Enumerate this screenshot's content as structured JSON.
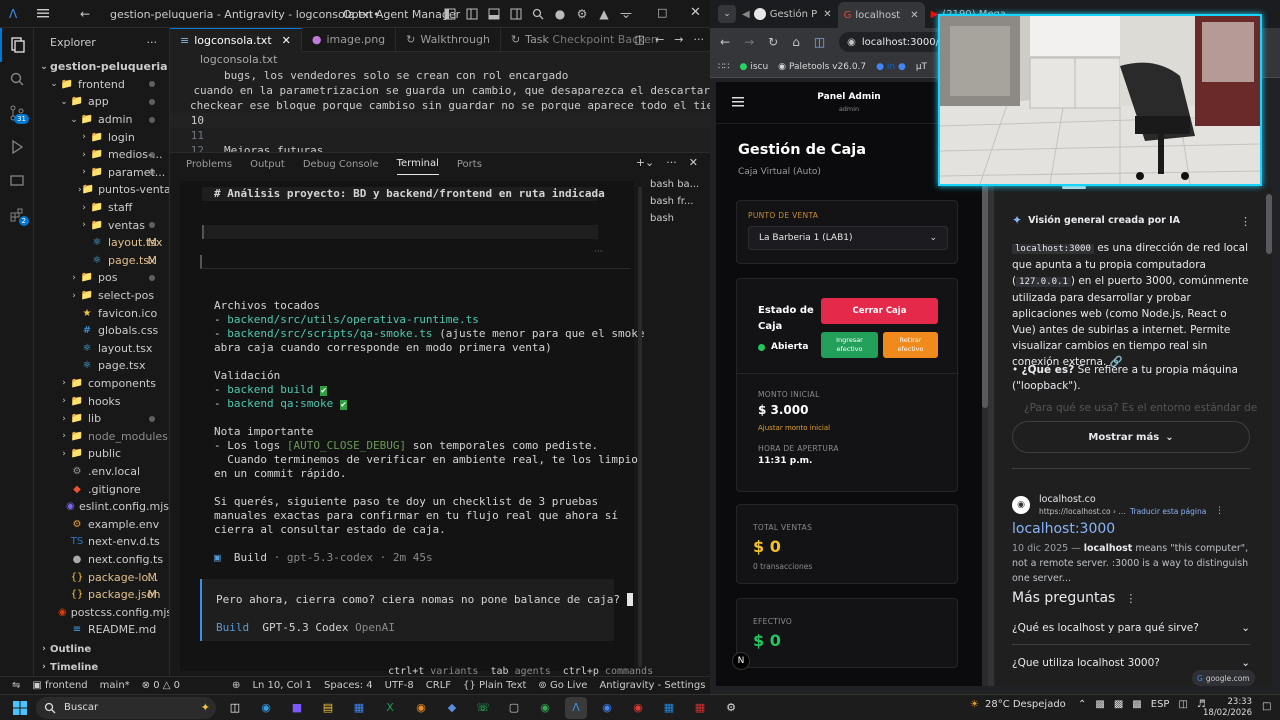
{
  "vscode": {
    "title": "gestion-peluqueria - Antigravity - logconsola.txt•",
    "open_agent_manager": "Open Agent Manager",
    "explorer_label": "Explorer",
    "tree": [
      {
        "label": "gestion-peluqueria",
        "depth": 0,
        "type": "root",
        "chev": "⌄",
        "dot": false
      },
      {
        "label": "frontend",
        "depth": 1,
        "type": "folder",
        "chev": "⌄",
        "dot": true
      },
      {
        "label": "app",
        "depth": 2,
        "type": "folder",
        "chev": "⌄",
        "dot": true
      },
      {
        "label": "admin",
        "depth": 3,
        "type": "folder",
        "chev": "⌄",
        "dot": true
      },
      {
        "label": "login",
        "depth": 4,
        "type": "folder",
        "chev": "›",
        "dot": false
      },
      {
        "label": "medios-...",
        "depth": 4,
        "type": "folder",
        "chev": "›",
        "dot": true
      },
      {
        "label": "paramet...",
        "depth": 4,
        "type": "folder",
        "chev": "›",
        "dot": true
      },
      {
        "label": "puntos-venta",
        "depth": 4,
        "type": "folder",
        "chev": "›",
        "dot": false
      },
      {
        "label": "staff",
        "depth": 4,
        "type": "folder",
        "chev": "›",
        "dot": false
      },
      {
        "label": "ventas",
        "depth": 4,
        "type": "folder",
        "chev": "›",
        "dot": true
      },
      {
        "label": "layout.tsx",
        "depth": 4,
        "type": "tsx",
        "chev": "",
        "m": "M"
      },
      {
        "label": "page.tsx",
        "depth": 4,
        "type": "tsx",
        "chev": "",
        "m": "M"
      },
      {
        "label": "pos",
        "depth": 3,
        "type": "folder",
        "chev": "›",
        "dot": true
      },
      {
        "label": "select-pos",
        "depth": 3,
        "type": "folder",
        "chev": "›",
        "dot": false
      },
      {
        "label": "favicon.ico",
        "depth": 3,
        "type": "ico",
        "chev": ""
      },
      {
        "label": "globals.css",
        "depth": 3,
        "type": "css",
        "chev": ""
      },
      {
        "label": "layout.tsx",
        "depth": 3,
        "type": "tsx",
        "chev": ""
      },
      {
        "label": "page.tsx",
        "depth": 3,
        "type": "tsx",
        "chev": ""
      },
      {
        "label": "components",
        "depth": 2,
        "type": "folder",
        "chev": "›",
        "dot": false
      },
      {
        "label": "hooks",
        "depth": 2,
        "type": "folder",
        "chev": "›",
        "dot": false
      },
      {
        "label": "lib",
        "depth": 2,
        "type": "folder",
        "chev": "›",
        "dot": true
      },
      {
        "label": "node_modules",
        "depth": 2,
        "type": "folder-dim",
        "chev": "›",
        "dot": false
      },
      {
        "label": "public",
        "depth": 2,
        "type": "folder",
        "chev": "›",
        "dot": false
      },
      {
        "label": ".env.local",
        "depth": 2,
        "type": "env",
        "chev": ""
      },
      {
        "label": ".gitignore",
        "depth": 2,
        "type": "git",
        "chev": ""
      },
      {
        "label": "eslint.config.mjs",
        "depth": 2,
        "type": "js",
        "chev": ""
      },
      {
        "label": "example.env",
        "depth": 2,
        "type": "env2",
        "chev": ""
      },
      {
        "label": "next-env.d.ts",
        "depth": 2,
        "type": "ts",
        "chev": ""
      },
      {
        "label": "next.config.ts",
        "depth": 2,
        "type": "ts2",
        "chev": ""
      },
      {
        "label": "package-lo...",
        "depth": 2,
        "type": "json",
        "chev": "",
        "m": "M"
      },
      {
        "label": "package.json",
        "depth": 2,
        "type": "json",
        "chev": "",
        "m": "M"
      },
      {
        "label": "postcss.config.mjs",
        "depth": 2,
        "type": "pcss",
        "chev": ""
      },
      {
        "label": "README.md",
        "depth": 2,
        "type": "md",
        "chev": ""
      }
    ],
    "outline": "Outline",
    "timeline": "Timeline",
    "tabs": [
      {
        "label": "logconsola.txt",
        "active": true
      },
      {
        "label": "image.png",
        "active": false
      },
      {
        "label": "Walkthrough",
        "active": false
      },
      {
        "label": "Task",
        "sub": "Checkpoint Backen",
        "active": false
      }
    ],
    "breadcrumb": "logconsola.txt",
    "code_lines": [
      {
        "n": "",
        "text": "bugs, los vendedores solo se crean con rol encargado"
      },
      {
        "n": "",
        "text": "cuando en la parametrizacion se guarda un cambio, que desaparezca el descartar"
      },
      {
        "n": "",
        "text": "checkear ese bloque porque cambiso sin guardar no se porque aparece todo el tie"
      },
      {
        "n": "10",
        "text": ""
      },
      {
        "n": "11",
        "text": ""
      },
      {
        "n": "12",
        "text": "Mejoras futuras"
      }
    ],
    "panel_tabs": [
      "Problems",
      "Output",
      "Debug Console",
      "Terminal",
      "Ports"
    ],
    "terminals": [
      "bash ba...",
      "bash fr...",
      "bash"
    ],
    "term": {
      "heading": "# Análisis proyecto: BD y backend/frontend en ruta indicada",
      "archivos_title": "Archivos tocados",
      "file1": "backend/src/utils/operativa-runtime.ts",
      "file2": "backend/src/scripts/qa-smoke.ts",
      "file2_note": "(ajuste menor para que el smoke",
      "file2_note2": "abra caja cuando corresponde en modo primera venta)",
      "validacion": "Validación",
      "v1": "backend build",
      "v2": "backend qa:smoke",
      "nota_title": "Nota importante",
      "nota1a": "- Los logs ",
      "nota1b": "[AUTO_CLOSE_DEBUG]",
      "nota1c": " son temporales como pediste.",
      "nota2": "  Cuando terminemos de verificar en ambiente real, te los limpio",
      "nota3": "en un commit rápido.",
      "p1": "Si querés, siguiente paso te doy un checklist de 3 pruebas",
      "p2": "manuales exactas para confirmar en tu flujo real que ahora sí",
      "p3": "cierra al consultar estado de caja.",
      "build_word": "Build",
      "build_meta": "· gpt-5.3-codex · 2m 45s",
      "prompt": "Pero ahora, cierra como? ciera nomas no pone balance de caja?",
      "mode": "Build",
      "model": "GPT-5.3 Codex",
      "provider": "OpenAI",
      "hint1k": "ctrl+t",
      "hint1": "variants",
      "hint2k": "tab",
      "hint2": "agents",
      "hint3k": "ctrl+p",
      "hint3": "commands"
    },
    "status": {
      "project": "frontend",
      "branch": "main*",
      "errors": "0",
      "warnings": "0",
      "position": "Ln 10, Col 1",
      "spaces": "Spaces: 4",
      "encoding": "UTF-8",
      "eol": "CRLF",
      "language": "Plain Text",
      "golive": "Go Live",
      "settings": "Antigravity - Settings"
    }
  },
  "chrome": {
    "tabs": [
      {
        "label": "Gestión P",
        "active": false
      },
      {
        "label": "localhost",
        "active": true
      },
      {
        "label": "(2190) Mega...",
        "active": false
      }
    ],
    "url": "localhost:3000/ad",
    "bookmarks": [
      "iscu",
      "Paletools v26.0.7",
      "µT"
    ],
    "app": {
      "header_title": "Panel Admin",
      "header_sub": "admin",
      "page_title": "Gestión de Caja",
      "page_sub": "Caja Virtual (Auto)",
      "pv_label": "PUNTO DE VENTA",
      "pv_value": "La Barberia 1 (LAB1)",
      "estado_label": "Estado de Caja",
      "estado_value": "Abierta",
      "cerrar_btn": "Cerrar Caja",
      "ingresar_btn": "Ingresar efectivo",
      "retirar_btn": "Retirar efectivo",
      "monto_label": "MONTO INICIAL",
      "monto_value": "$ 3.000",
      "ajustar": "Ajustar monto inicial",
      "hora_label": "HORA DE APERTURA",
      "hora_value": "11:31 p.m.",
      "total_label": "TOTAL VENTAS",
      "total_value": "$ 0",
      "trans": "0 transacciones",
      "efectivo_label": "EFECTIVO",
      "efectivo_value": "$ 0",
      "n_badge": "N"
    },
    "google": {
      "ai_title": "Visión general creada por IA",
      "ai_p1a": "localhost:3000",
      "ai_p1b": " es una dirección de red local que apunta a tu propia computadora (",
      "ai_p1c": "127.0.0.1",
      "ai_p1d": ") en el puerto 3000, comúnmente utilizada para desarrollar y probar aplicaciones web (como Node.js, React o Vue) antes de subirlas a internet. Permite visualizar cambios en tiempo real sin conexión externa.",
      "bullet_b": "¿Qué es?",
      "bullet_t": " Se refiere a tu propia máquina (\"loopback\").",
      "faded": "¿Para qué se usa? Es el entorno estándar de",
      "mostrar": "Mostrar más",
      "site_name": "localhost.co",
      "site_url": "https://localhost.co › ...",
      "traducir": "Traducir esta página",
      "result_title": "localhost:3000",
      "snip_date": "10 dic 2025 — ",
      "snip_b": "localhost",
      "snip_t": " means \"this computer\", not a remote server. :3000 is a way to distinguish one server...",
      "mas_preguntas": "Más preguntas",
      "q1": "¿Qué es localhost y para qué sirve?",
      "q2": "¿Que utiliza localhost 3000?",
      "google_badge": "google.com"
    }
  },
  "taskbar": {
    "search": "Buscar",
    "weather": "28°C  Despejado",
    "lang": "ESP",
    "time": "23:33",
    "date": "18/02/2026"
  },
  "colors": {
    "accent": "#0078d4",
    "red_btn": "#e5294b",
    "green_btn": "#22a05a",
    "orange_btn": "#f08a1c",
    "green_dot": "#22c55e",
    "link_blue": "#8ab4f8",
    "cam_border": "#19d4ff"
  }
}
